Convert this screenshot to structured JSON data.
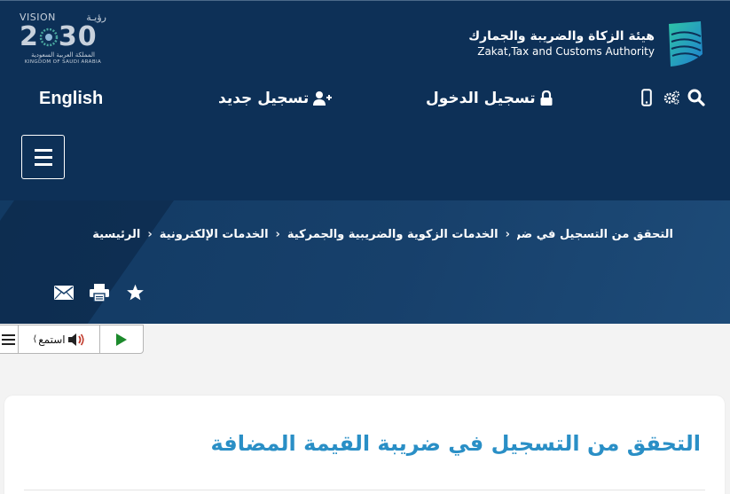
{
  "header": {
    "zatca_name_ar": "هيئة الزكاة والضريبة والجمارك",
    "zatca_name_en": "Zakat,Tax and Customs Authority",
    "vision": {
      "word": "VISION",
      "word_ar": "رؤيـة",
      "year": "2030",
      "kingdom_ar": "المملكة العربية السعودية",
      "kingdom_en": "KINGDOM OF SAUDI ARABIA"
    },
    "nav": {
      "language": "English",
      "register": "تسجيل جديد",
      "login": "تسجيل الدخول"
    }
  },
  "breadcrumb": {
    "items": [
      "الرئيسية",
      "الخدمات الإلكترونية",
      "الخدمات الزكوية والضريبية والجمركية",
      "التحقق من التسجيل في ضريبة القيمة المضافة"
    ]
  },
  "listen_bar": {
    "listen_label": "استمع"
  },
  "content": {
    "title": "التحقق من التسجيل في ضريبة القيمة المضافة"
  },
  "colors": {
    "header_bg": "#0d3057",
    "title_blue": "#2a8fc6",
    "play_green": "#1c8a2c"
  }
}
